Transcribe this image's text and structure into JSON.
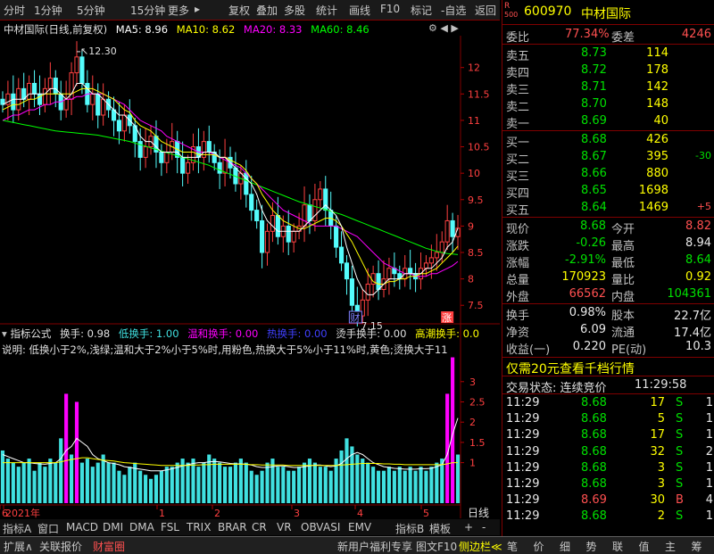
{
  "toolbar": {
    "left_items": [
      "分时",
      "1分钟",
      "5分钟",
      "15分钟",
      "更多"
    ],
    "right_items": [
      "复权",
      "叠加",
      "多股",
      "统计",
      "画线",
      "F10",
      "标记",
      "-自选",
      "返回"
    ]
  },
  "stock": {
    "code": "600970",
    "name": "中材国际",
    "badge_top": "R",
    "badge_bottom": "500"
  },
  "title_bar": {
    "name": "中材国际(日线,前复权)",
    "ma5_label": "MA5: 8.96",
    "ma10_label": "MA10: 8.62",
    "ma20_label": "MA20: 8.33",
    "ma60_label": "MA60: 8.46",
    "colors": {
      "ma5": "#ffffff",
      "ma10": "#ffff00",
      "ma20": "#ff00ff",
      "ma60": "#00ff00"
    }
  },
  "indicator_bar": {
    "name": "指标公式",
    "huanshou": "换手: 0.98",
    "low": "低换手: 1.00",
    "mild": "温和换手: 0.00",
    "hot": "热换手: 0.00",
    "boil": "烫手换手: 0.00",
    "peak": "高潮换手: 0.0",
    "explain": "说明: 低换小于2%,浅绿;温和大于2%小于5%时,用粉色,热换大于5%小于11%时,黄色;烫换大于11"
  },
  "chart_data": [
    {
      "type": "candlestick",
      "ylim": [
        7.2,
        12.4
      ],
      "y_ticks": [
        7.5,
        8.0,
        8.5,
        9.0,
        9.5,
        10.0,
        10.5,
        11.0,
        11.5,
        12.0
      ],
      "annotations": {
        "high": "12.30",
        "low": "7.15",
        "marker_cai": "财",
        "marker_zhang": "涨"
      },
      "series": {
        "close": [
          11.3,
          11.5,
          11.2,
          11.6,
          11.4,
          11.7,
          11.5,
          11.3,
          11.6,
          11.8,
          11.5,
          11.2,
          11.4,
          11.9,
          12.2,
          11.7,
          11.3,
          11.5,
          11.1,
          11.4,
          11.2,
          11.0,
          10.8,
          11.1,
          10.9,
          10.6,
          10.3,
          10.5,
          10.7,
          10.4,
          10.2,
          10.4,
          10.6,
          10.3,
          10.0,
          10.2,
          10.5,
          10.3,
          10.6,
          10.4,
          10.2,
          10.0,
          10.3,
          10.1,
          9.8,
          10.0,
          9.6,
          9.3,
          9.1,
          8.5,
          8.9,
          9.2,
          8.8,
          9.0,
          8.7,
          8.9,
          9.0,
          9.4,
          9.1,
          9.5,
          9.7,
          9.3,
          9.0,
          8.6,
          8.3,
          8.0,
          7.5,
          7.3,
          7.6,
          7.9,
          8.1,
          7.8,
          8.0,
          8.2,
          8.1,
          8.0,
          8.2,
          8.1,
          8.0,
          8.2,
          8.3,
          8.4,
          8.5,
          8.7,
          9.1,
          8.8,
          8.96
        ],
        "ma5": [
          11.3,
          11.35,
          11.4,
          11.4,
          11.4,
          11.5,
          11.5,
          11.5,
          11.5,
          11.6,
          11.6,
          11.5,
          11.4,
          11.5,
          11.7,
          11.7,
          11.6,
          11.5,
          11.5,
          11.4,
          11.3,
          11.2,
          11.1,
          11.1,
          11.0,
          10.9,
          10.7,
          10.6,
          10.6,
          10.5,
          10.4,
          10.4,
          10.4,
          10.4,
          10.3,
          10.3,
          10.3,
          10.3,
          10.4,
          10.4,
          10.4,
          10.3,
          10.3,
          10.2,
          10.1,
          10.0,
          9.9,
          9.8,
          9.6,
          9.3,
          9.1,
          9.0,
          8.9,
          8.9,
          8.9,
          8.9,
          8.9,
          9.0,
          9.1,
          9.2,
          9.3,
          9.4,
          9.3,
          9.2,
          9.0,
          8.6,
          8.3,
          8.0,
          7.8,
          7.7,
          7.7,
          7.8,
          7.9,
          8.0,
          8.0,
          8.0,
          8.1,
          8.1,
          8.1,
          8.1,
          8.2,
          8.2,
          8.3,
          8.4,
          8.6,
          8.7,
          8.96
        ],
        "ma10": [
          11.2,
          11.25,
          11.3,
          11.3,
          11.35,
          11.4,
          11.4,
          11.45,
          11.5,
          11.5,
          11.5,
          11.5,
          11.5,
          11.5,
          11.55,
          11.6,
          11.6,
          11.6,
          11.55,
          11.5,
          11.45,
          11.4,
          11.3,
          11.2,
          11.15,
          11.0,
          10.9,
          10.85,
          10.8,
          10.7,
          10.6,
          10.55,
          10.5,
          10.45,
          10.4,
          10.4,
          10.4,
          10.35,
          10.35,
          10.35,
          10.35,
          10.3,
          10.3,
          10.25,
          10.2,
          10.15,
          10.05,
          9.9,
          9.8,
          9.6,
          9.45,
          9.3,
          9.2,
          9.1,
          9.05,
          9.0,
          8.95,
          8.95,
          9.0,
          9.05,
          9.1,
          9.15,
          9.15,
          9.1,
          9.0,
          8.85,
          8.7,
          8.5,
          8.3,
          8.1,
          7.95,
          7.9,
          7.9,
          7.95,
          7.95,
          8.0,
          8.0,
          8.05,
          8.05,
          8.1,
          8.1,
          8.15,
          8.2,
          8.3,
          8.4,
          8.5,
          8.62
        ],
        "ma20": [
          11.0,
          11.05,
          11.1,
          11.1,
          11.15,
          11.2,
          11.2,
          11.25,
          11.3,
          11.3,
          11.35,
          11.35,
          11.4,
          11.4,
          11.45,
          11.45,
          11.5,
          11.5,
          11.5,
          11.5,
          11.45,
          11.4,
          11.35,
          11.3,
          11.2,
          11.1,
          11.0,
          10.95,
          10.9,
          10.85,
          10.8,
          10.7,
          10.65,
          10.6,
          10.55,
          10.5,
          10.45,
          10.4,
          10.4,
          10.4,
          10.35,
          10.3,
          10.25,
          10.2,
          10.15,
          10.1,
          10.0,
          9.9,
          9.8,
          9.7,
          9.6,
          9.5,
          9.4,
          9.3,
          9.25,
          9.2,
          9.15,
          9.1,
          9.05,
          9.0,
          9.0,
          9.0,
          9.0,
          9.0,
          8.95,
          8.9,
          8.85,
          8.8,
          8.7,
          8.6,
          8.5,
          8.4,
          8.3,
          8.25,
          8.2,
          8.15,
          8.1,
          8.1,
          8.05,
          8.05,
          8.05,
          8.1,
          8.1,
          8.15,
          8.2,
          8.25,
          8.33
        ],
        "ma60": [
          11.0,
          10.98,
          10.96,
          10.94,
          10.92,
          10.9,
          10.88,
          10.86,
          10.84,
          10.82,
          10.8,
          10.79,
          10.78,
          10.77,
          10.76,
          10.75,
          10.74,
          10.73,
          10.72,
          10.7,
          10.68,
          10.66,
          10.64,
          10.62,
          10.6,
          10.57,
          10.54,
          10.51,
          10.48,
          10.45,
          10.42,
          10.39,
          10.36,
          10.33,
          10.3,
          10.27,
          10.24,
          10.21,
          10.18,
          10.15,
          10.1,
          10.06,
          10.02,
          9.98,
          9.94,
          9.9,
          9.86,
          9.82,
          9.78,
          9.74,
          9.7,
          9.66,
          9.62,
          9.58,
          9.54,
          9.5,
          9.46,
          9.43,
          9.4,
          9.37,
          9.34,
          9.31,
          9.28,
          9.25,
          9.22,
          9.18,
          9.14,
          9.1,
          9.06,
          9.02,
          8.98,
          8.94,
          8.9,
          8.86,
          8.82,
          8.78,
          8.74,
          8.7,
          8.66,
          8.62,
          8.58,
          8.55,
          8.52,
          8.5,
          8.48,
          8.47,
          8.46
        ]
      },
      "x_labels": [
        "2021年",
        "1",
        "2",
        "3",
        "4",
        "5",
        "6"
      ]
    },
    {
      "type": "bar",
      "ylim": [
        0,
        3.7
      ],
      "y_ticks": [
        1.0,
        1.5,
        2.0,
        2.5,
        3.0
      ],
      "colors": {
        "low": "#40e0e0",
        "mild": "#ff00ff"
      },
      "values": [
        1.3,
        1.1,
        1.0,
        0.9,
        1.0,
        1.1,
        0.8,
        1.0,
        0.9,
        1.1,
        1.0,
        1.6,
        2.7,
        1.2,
        2.5,
        1.0,
        1.1,
        0.9,
        1.0,
        1.2,
        1.0,
        1.0,
        0.8,
        0.7,
        0.9,
        1.0,
        0.8,
        0.7,
        0.6,
        0.7,
        0.8,
        0.9,
        0.9,
        1.0,
        1.1,
        1.0,
        1.1,
        0.9,
        1.0,
        1.2,
        1.1,
        1.0,
        0.9,
        0.9,
        1.0,
        1.1,
        1.0,
        0.8,
        0.7,
        0.8,
        1.0,
        1.1,
        0.9,
        0.9,
        0.8,
        0.8,
        0.9,
        1.0,
        1.1,
        1.0,
        0.9,
        0.9,
        0.8,
        1.1,
        1.3,
        1.6,
        1.4,
        1.2,
        1.1,
        1.0,
        0.9,
        0.8,
        0.8,
        0.9,
        0.8,
        0.9,
        0.8,
        0.9,
        0.8,
        0.9,
        0.8,
        0.9,
        1.0,
        1.1,
        2.7,
        3.6,
        1.2
      ],
      "mild_indices": [
        12,
        14,
        84,
        85
      ],
      "ma_white": [
        1.2,
        1.15,
        1.1,
        1.05,
        1.0,
        1.0,
        0.98,
        0.97,
        0.96,
        0.98,
        1.0,
        1.1,
        1.3,
        1.4,
        1.6,
        1.5,
        1.4,
        1.2,
        1.1,
        1.05,
        1.0,
        0.98,
        0.95,
        0.9,
        0.88,
        0.86,
        0.84,
        0.82,
        0.8,
        0.8,
        0.8,
        0.82,
        0.85,
        0.88,
        0.92,
        0.95,
        0.98,
        1.0,
        1.0,
        1.02,
        1.03,
        1.02,
        1.0,
        0.98,
        0.97,
        0.97,
        0.96,
        0.94,
        0.9,
        0.88,
        0.88,
        0.9,
        0.92,
        0.92,
        0.9,
        0.88,
        0.88,
        0.9,
        0.92,
        0.94,
        0.94,
        0.92,
        0.9,
        0.92,
        0.98,
        1.1,
        1.2,
        1.25,
        1.2,
        1.1,
        1.0,
        0.95,
        0.9,
        0.88,
        0.86,
        0.85,
        0.84,
        0.84,
        0.84,
        0.85,
        0.85,
        0.86,
        0.9,
        0.95,
        1.2,
        1.7,
        2.1
      ],
      "ma_yellow": [
        1.0,
        1.0,
        1.0,
        1.0,
        1.0,
        1.0,
        1.0,
        1.0,
        1.0,
        1.0,
        1.0,
        1.02,
        1.05,
        1.08,
        1.1,
        1.12,
        1.12,
        1.1,
        1.08,
        1.06,
        1.05,
        1.04,
        1.02,
        1.0,
        0.99,
        0.98,
        0.97,
        0.96,
        0.95,
        0.94,
        0.93,
        0.93,
        0.93,
        0.93,
        0.93,
        0.93,
        0.94,
        0.94,
        0.95,
        0.95,
        0.96,
        0.96,
        0.96,
        0.96,
        0.96,
        0.96,
        0.96,
        0.95,
        0.95,
        0.94,
        0.94,
        0.94,
        0.94,
        0.94,
        0.93,
        0.93,
        0.93,
        0.93,
        0.93,
        0.93,
        0.93,
        0.93,
        0.93,
        0.93,
        0.94,
        0.95,
        0.96,
        0.97,
        0.98,
        0.98,
        0.98,
        0.98,
        0.97,
        0.97,
        0.96,
        0.96,
        0.95,
        0.95,
        0.95,
        0.95,
        0.95,
        0.95,
        0.95,
        0.95,
        0.97,
        1.0,
        1.0
      ]
    }
  ],
  "orderbook": {
    "weibi_label": "委比",
    "weibi_value": "77.34%",
    "weicha_label": "委差",
    "weicha_value": "4246",
    "asks": [
      {
        "label": "卖五",
        "price": "8.73",
        "vol": "114"
      },
      {
        "label": "卖四",
        "price": "8.72",
        "vol": "178"
      },
      {
        "label": "卖三",
        "price": "8.71",
        "vol": "142"
      },
      {
        "label": "卖二",
        "price": "8.70",
        "vol": "148"
      },
      {
        "label": "卖一",
        "price": "8.69",
        "vol": "40"
      }
    ],
    "bids": [
      {
        "label": "买一",
        "price": "8.68",
        "vol": "426",
        "chg": ""
      },
      {
        "label": "买二",
        "price": "8.67",
        "vol": "395",
        "chg": "-30"
      },
      {
        "label": "买三",
        "price": "8.66",
        "vol": "880",
        "chg": ""
      },
      {
        "label": "买四",
        "price": "8.65",
        "vol": "1698",
        "chg": ""
      },
      {
        "label": "买五",
        "price": "8.64",
        "vol": "1469",
        "chg": "+5"
      }
    ]
  },
  "quote": [
    {
      "l1": "现价",
      "v1": "8.68",
      "c1": "grn",
      "l2": "今开",
      "v2": "8.82",
      "c2": "red"
    },
    {
      "l1": "涨跌",
      "v1": "-0.26",
      "c1": "grn",
      "l2": "最高",
      "v2": "8.94",
      "c2": "wht"
    },
    {
      "l1": "涨幅",
      "v1": "-2.91%",
      "c1": "grn",
      "l2": "最低",
      "v2": "8.64",
      "c2": "grn"
    },
    {
      "l1": "总量",
      "v1": "170923",
      "c1": "yel",
      "l2": "量比",
      "v2": "0.92",
      "c2": "yel"
    },
    {
      "l1": "外盘",
      "v1": "66562",
      "c1": "red",
      "l2": "内盘",
      "v2": "104361",
      "c2": "grn"
    }
  ],
  "fundamentals": [
    {
      "l1": "换手",
      "v1": "0.98%",
      "l2": "股本",
      "v2": "22.7亿"
    },
    {
      "l1": "净资",
      "v1": "6.09",
      "l2": "流通",
      "v2": "17.4亿"
    },
    {
      "l1": "收益(一)",
      "v1": "0.220",
      "l2": "PE(动)",
      "v2": "10.3"
    }
  ],
  "promo": "仅需20元查看千档行情",
  "trade_status": {
    "label": "交易状态: 连续竞价",
    "time": "11:29:58"
  },
  "ticks": [
    {
      "time": "11:29",
      "price": "8.68",
      "vol": "17",
      "side": "S",
      "n": "1"
    },
    {
      "time": "11:29",
      "price": "8.68",
      "vol": "5",
      "side": "S",
      "n": "1"
    },
    {
      "time": "11:29",
      "price": "8.68",
      "vol": "17",
      "side": "S",
      "n": "1"
    },
    {
      "time": "11:29",
      "price": "8.68",
      "vol": "32",
      "side": "S",
      "n": "2"
    },
    {
      "time": "11:29",
      "price": "8.68",
      "vol": "3",
      "side": "S",
      "n": "1"
    },
    {
      "time": "11:29",
      "price": "8.68",
      "vol": "3",
      "side": "S",
      "n": "1"
    },
    {
      "time": "11:29",
      "price": "8.69",
      "vol": "30",
      "side": "B",
      "n": "4"
    },
    {
      "time": "11:29",
      "price": "8.68",
      "vol": "2",
      "side": "S",
      "n": "1"
    }
  ],
  "indicator_tabs": [
    "指标A",
    "窗口",
    "MACD",
    "DMI",
    "DMA",
    "FSL",
    "TRIX",
    "BRAR",
    "CR",
    "VR",
    "OBV",
    "ASI",
    "EMV"
  ],
  "indicator_tabs_right": [
    "指标B",
    "模板",
    "+",
    "-"
  ],
  "right_tab": "日线",
  "bottom_left": [
    "扩展∧",
    "关联报价",
    "财富圈"
  ],
  "bottom_mid": [
    "新用户福利专享",
    "图文F10",
    "侧边栏≪"
  ],
  "bottom_right": [
    "笔",
    "价",
    "细",
    "势",
    "联",
    "值",
    "主",
    "筹"
  ]
}
